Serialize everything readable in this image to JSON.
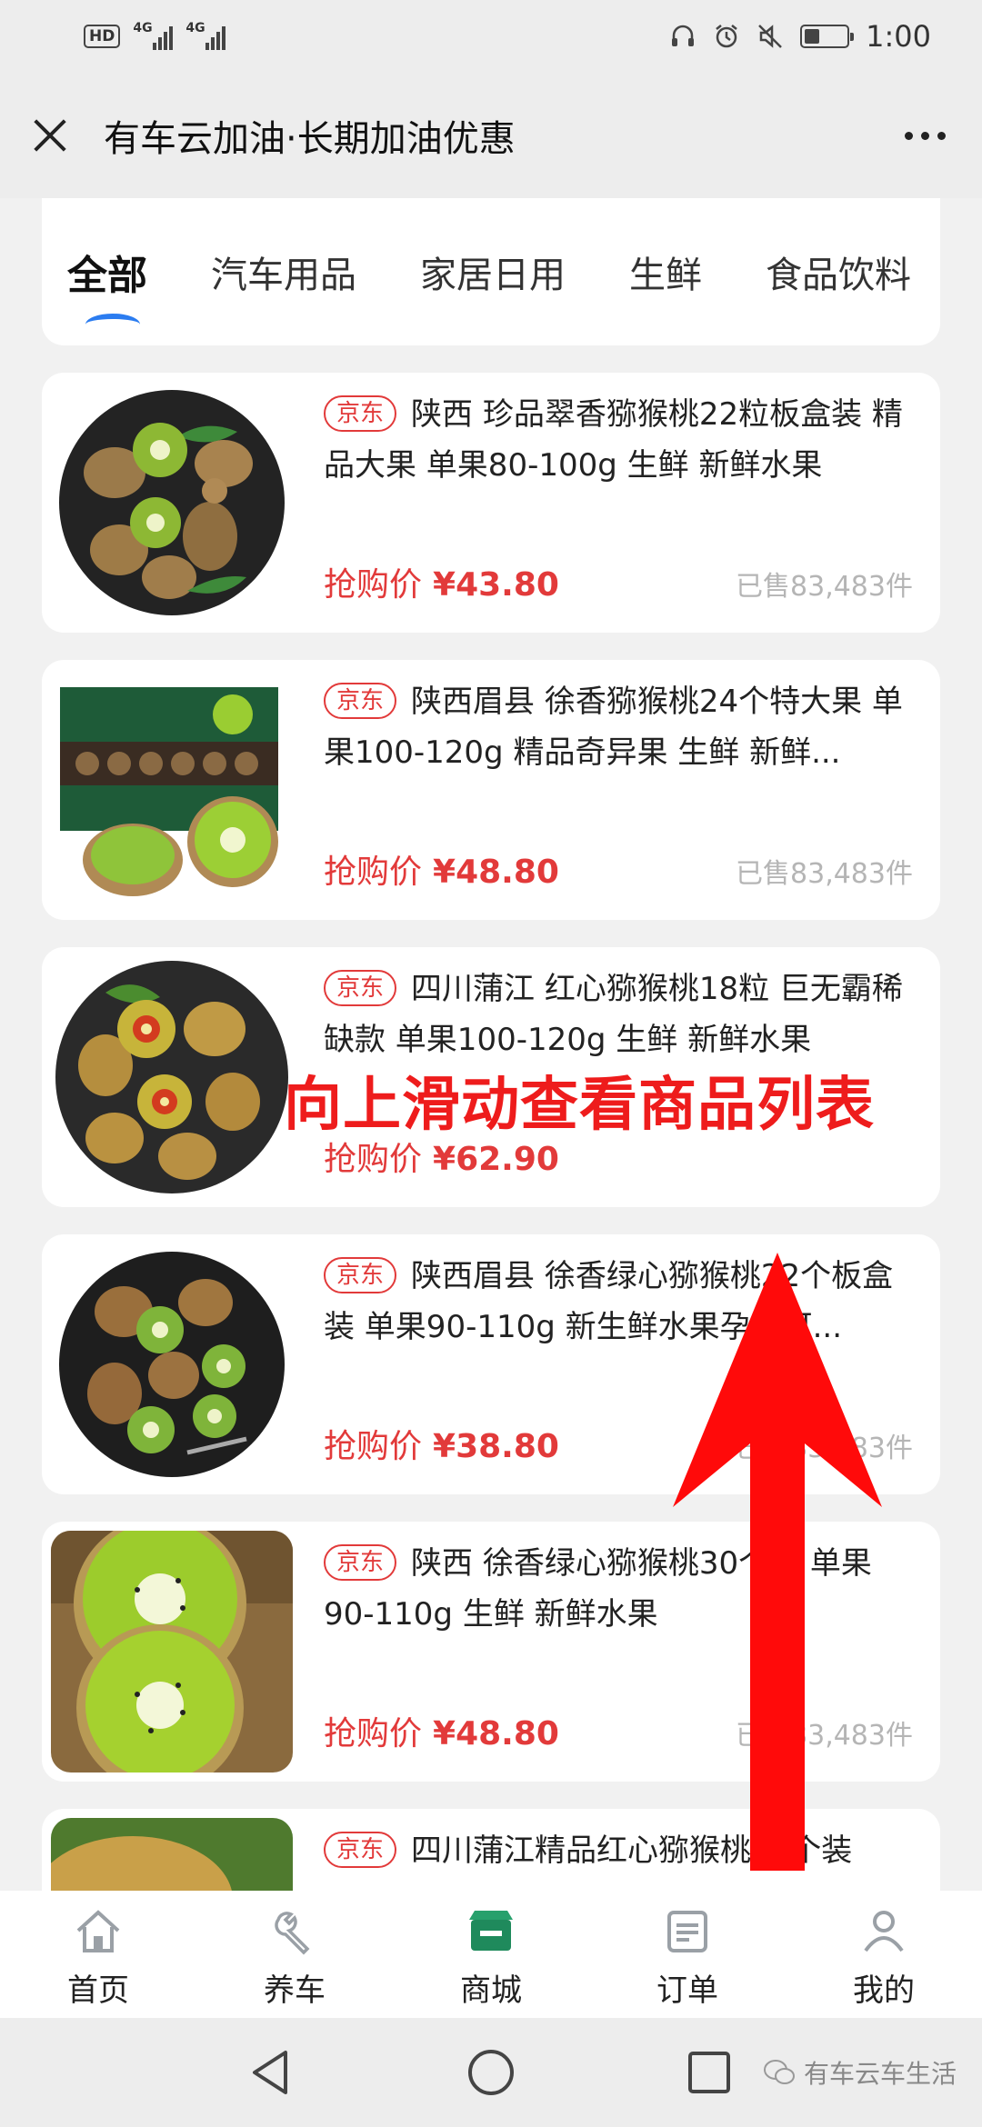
{
  "status_bar": {
    "hd": "HD",
    "net1": "4G",
    "net2": "4G",
    "battery_level": 0.35,
    "time": "1:00"
  },
  "header": {
    "title": "有车云加油·长期加油优惠"
  },
  "tabs": [
    {
      "label": "全部",
      "active": true
    },
    {
      "label": "汽车用品",
      "active": false
    },
    {
      "label": "家居日用",
      "active": false
    },
    {
      "label": "生鲜",
      "active": false
    },
    {
      "label": "食品饮料",
      "active": false
    }
  ],
  "products": [
    {
      "tag": "京东",
      "name": "陕西 珍品翠香猕猴桃22粒板盒装 精品大果 单果80-100g 生鲜 新鲜水果",
      "price_label": "抢购价",
      "price": "¥43.80",
      "sold": "已售83,483件"
    },
    {
      "tag": "京东",
      "name": "陕西眉县 徐香猕猴桃24个特大果 单果100-120g 精品奇异果 生鲜 新鲜...",
      "price_label": "抢购价",
      "price": "¥48.80",
      "sold": "已售83,483件"
    },
    {
      "tag": "京东",
      "name": "四川蒲江 红心猕猴桃18粒 巨无霸稀缺款 单果100-120g 生鲜 新鲜水果",
      "price_label": "抢购价",
      "price": "¥62.90",
      "sold": ""
    },
    {
      "tag": "京东",
      "name": "陕西眉县 徐香绿心猕猴桃22个板盒装 单果90-110g 新生鲜水果孕妇可...",
      "price_label": "抢购价",
      "price": "¥38.80",
      "sold": "已售83,483件"
    },
    {
      "tag": "京东",
      "name": "陕西 徐香绿心猕猴桃30个装 单果90-110g 生鲜 新鲜水果",
      "price_label": "抢购价",
      "price": "¥48.80",
      "sold": "已售83,483件"
    },
    {
      "tag": "京东",
      "name": "四川蒲江精品红心猕猴桃12个装",
      "price_label": "",
      "price": "",
      "sold": ""
    }
  ],
  "overlay": {
    "text": "向上滑动查看商品列表"
  },
  "bottom_nav": [
    {
      "label": "首页",
      "icon": "home-icon"
    },
    {
      "label": "养车",
      "icon": "wrench-icon"
    },
    {
      "label": "商城",
      "icon": "store-icon"
    },
    {
      "label": "订单",
      "icon": "order-icon"
    },
    {
      "label": "我的",
      "icon": "profile-icon"
    }
  ],
  "watermark": "有车云车生活",
  "colors": {
    "accent_red": "#e23a3a",
    "tab_indicator": "#2b7cf0",
    "store_green": "#1f8a5c"
  }
}
